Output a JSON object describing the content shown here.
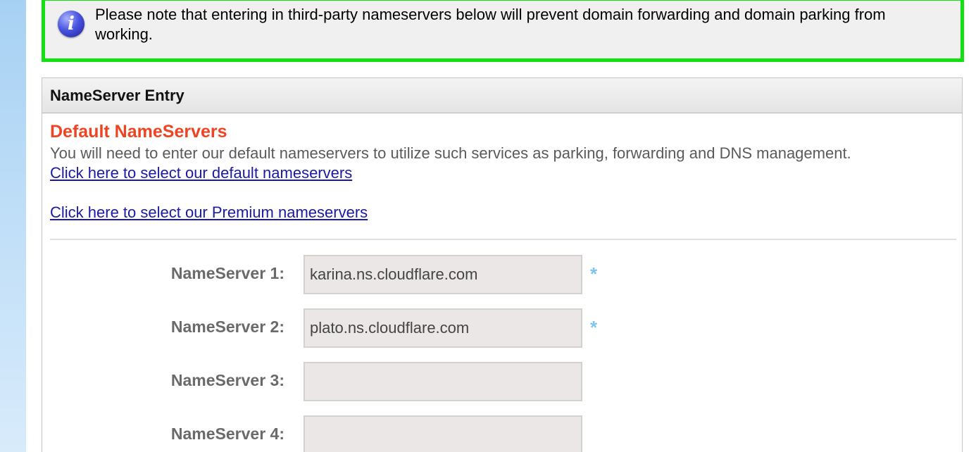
{
  "notice": {
    "icon": "info-icon",
    "text": "Please note that entering in third-party nameservers below will prevent domain forwarding and domain parking from working."
  },
  "panel": {
    "header": "NameServer Entry",
    "section_title": "Default NameServers",
    "description": "You will need to enter our default nameservers to utilize such services as parking, forwarding and DNS management.",
    "default_link": "Click here to select our default nameservers",
    "premium_link": "Click here to select our Premium nameservers"
  },
  "nameservers": [
    {
      "label": "NameServer 1:",
      "value": "karina.ns.cloudflare.com",
      "required": "*"
    },
    {
      "label": "NameServer 2:",
      "value": "plato.ns.cloudflare.com",
      "required": "*"
    },
    {
      "label": "NameServer 3:",
      "value": "",
      "required": ""
    },
    {
      "label": "NameServer 4:",
      "value": "",
      "required": ""
    }
  ],
  "colors": {
    "notice_border": "#11e011",
    "section_title": "#ee4422",
    "link": "#1a1aa6",
    "required_star": "#7cc6ee"
  }
}
